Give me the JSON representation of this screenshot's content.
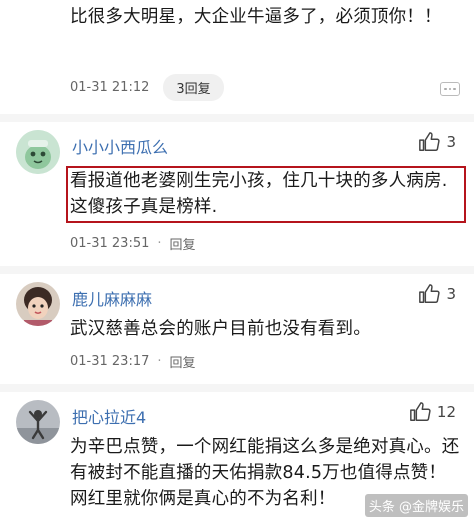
{
  "comments": [
    {
      "text": "比很多大明星，大企业牛逼多了，必须顶你！！",
      "time": "01-31 21:12",
      "reply_label": "3回复"
    },
    {
      "username": "小小小西瓜么",
      "likes": "3",
      "text": "看报道他老婆刚生完小孩，住几十块的多人病房.这傻孩子真是榜样.",
      "time": "01-31 23:51",
      "reply_label": "回复"
    },
    {
      "username": "鹿儿麻麻麻",
      "likes": "3",
      "text": "武汉慈善总会的账户目前也没有看到。",
      "time": "01-31 23:17",
      "reply_label": "回复"
    },
    {
      "username": "把心拉近4",
      "likes": "12",
      "text": "为辛巴点赞，一个网红能捐这么多是绝对真心。还有被封不能直播的天佑捐款84.5万也值得点赞！网红里就你俩是真心的不为名利！"
    }
  ],
  "watermark": "头条 @金牌娱乐",
  "colors": {
    "username": "#3d6fb0",
    "highlight_border": "#b5141c"
  }
}
